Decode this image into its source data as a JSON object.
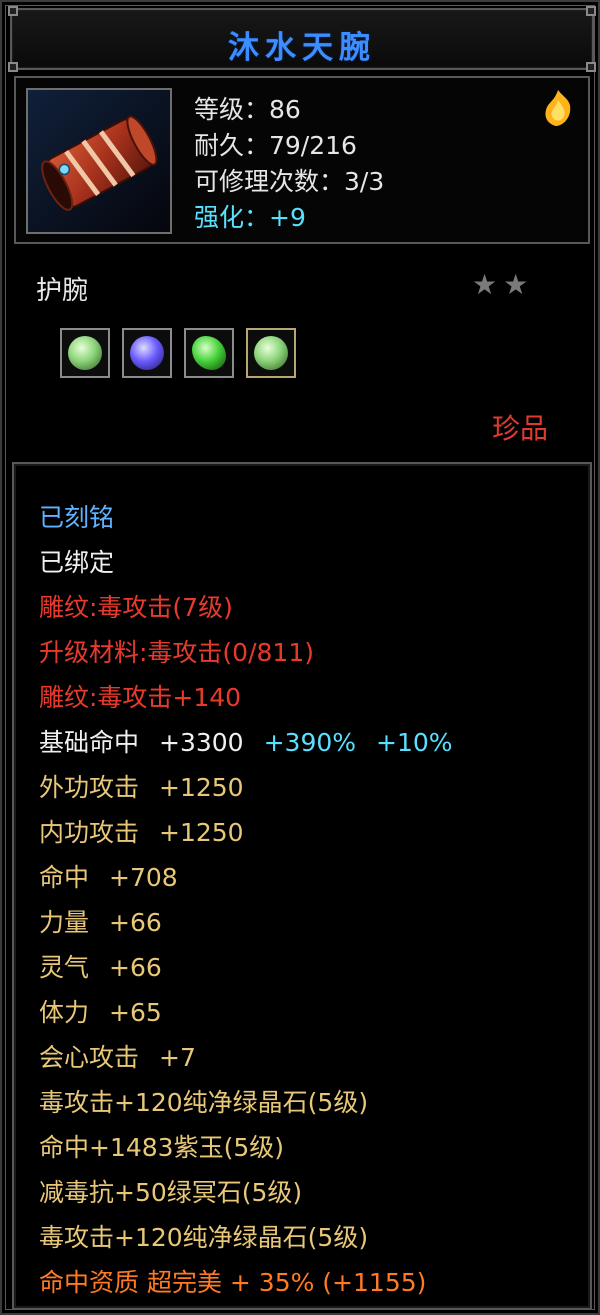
{
  "item": {
    "name": "沐水天腕",
    "stats": {
      "level": "等级：86",
      "durability": "耐久：79/216",
      "repairs": "可修理次数：3/3",
      "enhance": "强化：+9"
    },
    "type": "护腕",
    "star_count": 2,
    "rarity": "珍品",
    "gems": [
      {
        "name": "green-gem-icon",
        "color": "#8bd47a"
      },
      {
        "name": "purple-gem-icon",
        "color": "#6a5cff"
      },
      {
        "name": "green-crystal-icon",
        "color": "#46d23a"
      },
      {
        "name": "green-gem-icon",
        "color": "#8bd47a"
      }
    ]
  },
  "attributes": {
    "engraved": "已刻铭",
    "bound": "已绑定",
    "carving": "雕纹:毒攻击(7级)",
    "upgrade_material": "升级材料:毒攻击(0/811)",
    "carving_bonus": "雕纹:毒攻击+140",
    "base_hit_label": "基础命中",
    "base_hit_value": "+3300",
    "base_hit_pct1": "+390%",
    "base_hit_pct2": "+10%",
    "outer_attack_label": "外功攻击",
    "outer_attack_value": "+1250",
    "inner_attack_label": "内功攻击",
    "inner_attack_value": "+1250",
    "hit_label": "命中",
    "hit_value": "+708",
    "strength_label": "力量",
    "strength_value": "+66",
    "spirit_label": "灵气",
    "spirit_value": "+66",
    "stamina_label": "体力",
    "stamina_value": "+65",
    "crit_label": "会心攻击",
    "crit_value": "+7",
    "gem1": "毒攻击+120纯净绿晶石(5级)",
    "gem2": "命中+1483紫玉(5级)",
    "gem3": "减毒抗+50绿冥石(5级)",
    "gem4": "毒攻击+120纯净绿晶石(5级)",
    "quality": "命中资质 超完美 + 35% (+1155)"
  }
}
